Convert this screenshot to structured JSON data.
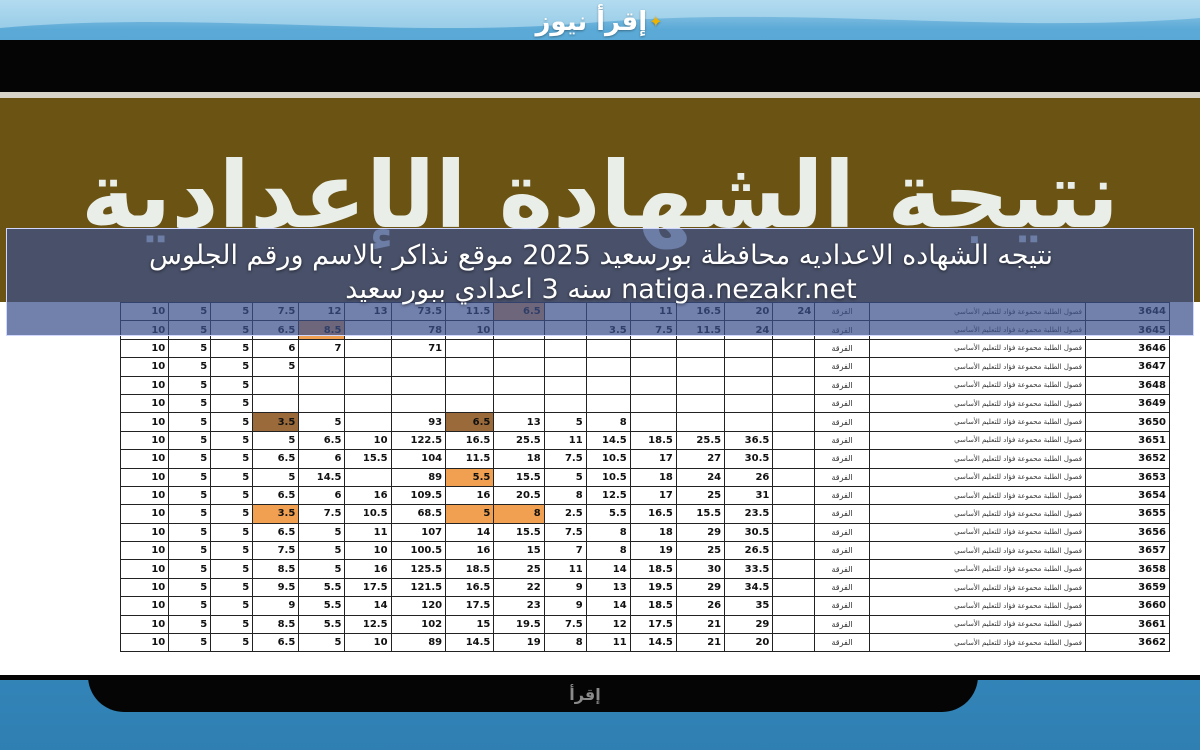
{
  "site_logo": {
    "text": "إقرأ نيوز"
  },
  "banner": {
    "title": "نتيجة الشهادة الإعدادية"
  },
  "headline": {
    "text": "نتيجه الشهاده الاعداديه محافظة بورسعيد 2025 موقع نذاكر بالاسم ورقم الجلوس natiga.nezakr.net سنه 3 اعدادي ببورسعيد"
  },
  "bottom_logo": {
    "text": "إقرأ"
  },
  "table": {
    "rows": [
      {
        "cells": [
          "10",
          "5",
          "5",
          "7.5",
          "12",
          "13",
          "73.5",
          "11.5",
          "6.5",
          "",
          "",
          "11",
          "16.5",
          "20",
          "24",
          "الفرقة",
          "فصول الطلبة محموعة فؤاد للتعليم الأساسي",
          "3644"
        ],
        "hl": [
          8
        ]
      },
      {
        "cells": [
          "10",
          "5",
          "5",
          "6.5",
          "8.5",
          "",
          "78",
          "10",
          "",
          "",
          "3.5",
          "7.5",
          "11.5",
          "24",
          "",
          "الفرقة",
          "فصول الطلبة محموعة فؤاد للتعليم الأساسي",
          "3645"
        ],
        "hl": [
          4
        ]
      },
      {
        "cells": [
          "10",
          "5",
          "5",
          "6",
          "7",
          "",
          "71",
          "",
          "",
          "",
          "",
          "",
          "",
          "",
          "",
          "الفرقة",
          "فصول الطلبة محموعة فؤاد للتعليم الأساسي",
          "3646"
        ],
        "hl": []
      },
      {
        "cells": [
          "10",
          "5",
          "5",
          "5",
          "",
          "",
          "",
          "",
          "",
          "",
          "",
          "",
          "",
          "",
          "",
          "الفرقة",
          "فصول الطلبة محموعة فؤاد للتعليم الأساسي",
          "3647"
        ],
        "hl": []
      },
      {
        "cells": [
          "10",
          "5",
          "5",
          "",
          "",
          "",
          "",
          "",
          "",
          "",
          "",
          "",
          "",
          "",
          "",
          "الفرقة",
          "فصول الطلبة محموعة فؤاد للتعليم الأساسي",
          "3648"
        ],
        "hl": []
      },
      {
        "cells": [
          "10",
          "5",
          "5",
          "",
          "",
          "",
          "",
          "",
          "",
          "",
          "",
          "",
          "",
          "",
          "",
          "الفرقة",
          "فصول الطلبة محموعة فؤاد للتعليم الأساسي",
          "3649"
        ],
        "hl": []
      },
      {
        "cells": [
          "10",
          "5",
          "5",
          "3.5",
          "5",
          "",
          "93",
          "6.5",
          "13",
          "5",
          "8",
          "",
          "",
          "",
          "",
          "الفرقة",
          "فصول الطلبة محموعة فؤاد للتعليم الأساسي",
          "3650"
        ],
        "hld": [
          3,
          7
        ]
      },
      {
        "cells": [
          "10",
          "5",
          "5",
          "5",
          "6.5",
          "10",
          "122.5",
          "16.5",
          "25.5",
          "11",
          "14.5",
          "18.5",
          "25.5",
          "36.5",
          "",
          "الفرقة",
          "فصول الطلبة محموعة فؤاد للتعليم الأساسي",
          "3651"
        ],
        "hl": []
      },
      {
        "cells": [
          "10",
          "5",
          "5",
          "6.5",
          "6",
          "15.5",
          "104",
          "11.5",
          "18",
          "7.5",
          "10.5",
          "17",
          "27",
          "30.5",
          "",
          "الفرقة",
          "فصول الطلبة محموعة فؤاد للتعليم الأساسي",
          "3652"
        ],
        "hl": []
      },
      {
        "cells": [
          "10",
          "5",
          "5",
          "5",
          "14.5",
          "",
          "89",
          "5.5",
          "15.5",
          "5",
          "10.5",
          "18",
          "24",
          "26",
          "",
          "الفرقة",
          "فصول الطلبة محموعة فؤاد للتعليم الأساسي",
          "3653"
        ],
        "hl": [
          7
        ]
      },
      {
        "cells": [
          "10",
          "5",
          "5",
          "6.5",
          "6",
          "16",
          "109.5",
          "16",
          "20.5",
          "8",
          "12.5",
          "17",
          "25",
          "31",
          "",
          "الفرقة",
          "فصول الطلبة محموعة فؤاد للتعليم الأساسي",
          "3654"
        ],
        "hl": []
      },
      {
        "cells": [
          "10",
          "5",
          "5",
          "3.5",
          "7.5",
          "10.5",
          "68.5",
          "5",
          "8",
          "2.5",
          "5.5",
          "16.5",
          "15.5",
          "23.5",
          "",
          "الفرقة",
          "فصول الطلبة محموعة فؤاد للتعليم الأساسي",
          "3655"
        ],
        "hl": [
          3,
          7,
          8
        ]
      },
      {
        "cells": [
          "10",
          "5",
          "5",
          "6.5",
          "5",
          "11",
          "107",
          "14",
          "15.5",
          "7.5",
          "8",
          "18",
          "29",
          "30.5",
          "",
          "الفرقة",
          "فصول الطلبة محموعة فؤاد للتعليم الأساسي",
          "3656"
        ],
        "hl": []
      },
      {
        "cells": [
          "10",
          "5",
          "5",
          "7.5",
          "5",
          "10",
          "100.5",
          "16",
          "15",
          "7",
          "8",
          "19",
          "25",
          "26.5",
          "",
          "الفرقة",
          "فصول الطلبة محموعة فؤاد للتعليم الأساسي",
          "3657"
        ],
        "hl": []
      },
      {
        "cells": [
          "10",
          "5",
          "5",
          "8.5",
          "5",
          "16",
          "125.5",
          "18.5",
          "25",
          "11",
          "14",
          "18.5",
          "30",
          "33.5",
          "",
          "الفرقة",
          "فصول الطلبة محموعة فؤاد للتعليم الأساسي",
          "3658"
        ],
        "hl": []
      },
      {
        "cells": [
          "10",
          "5",
          "5",
          "9.5",
          "5.5",
          "17.5",
          "121.5",
          "16.5",
          "22",
          "9",
          "13",
          "19.5",
          "29",
          "34.5",
          "",
          "الفرقة",
          "فصول الطلبة محموعة فؤاد للتعليم الأساسي",
          "3659"
        ],
        "hl": []
      },
      {
        "cells": [
          "10",
          "5",
          "5",
          "9",
          "5.5",
          "14",
          "120",
          "17.5",
          "23",
          "9",
          "14",
          "18.5",
          "26",
          "35",
          "",
          "الفرقة",
          "فصول الطلبة محموعة فؤاد للتعليم الأساسي",
          "3660"
        ],
        "hl": []
      },
      {
        "cells": [
          "10",
          "5",
          "5",
          "8.5",
          "5.5",
          "12.5",
          "102",
          "15",
          "19.5",
          "7.5",
          "12",
          "17.5",
          "21",
          "29",
          "",
          "الفرقة",
          "فصول الطلبة محموعة فؤاد للتعليم الأساسي",
          "3661"
        ],
        "hl": []
      },
      {
        "cells": [
          "10",
          "5",
          "5",
          "6.5",
          "5",
          "10",
          "89",
          "14.5",
          "19",
          "8",
          "11",
          "14.5",
          "21",
          "20",
          "",
          "الفرقة",
          "فصول الطلبة محموعة فؤاد للتعليم الأساسي",
          "3662"
        ],
        "hl": []
      }
    ]
  }
}
